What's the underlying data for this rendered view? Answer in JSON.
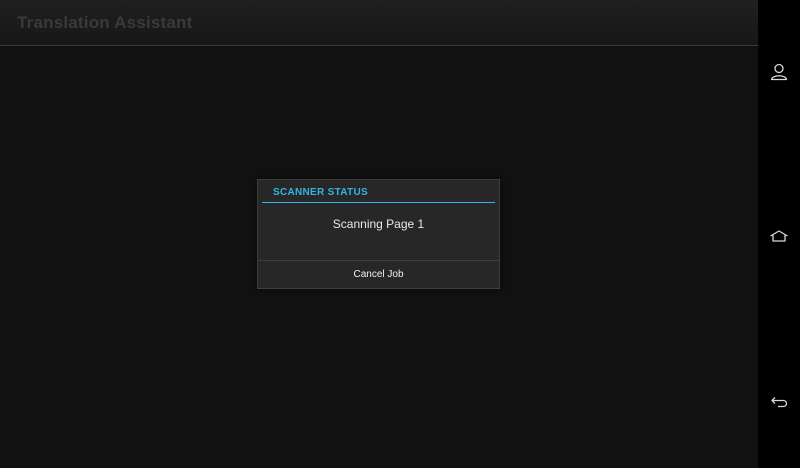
{
  "app": {
    "title": "Translation Assistant"
  },
  "dialog": {
    "title": "SCANNER STATUS",
    "message": "Scanning Page 1",
    "cancel_label": "Cancel Job"
  },
  "nav": {
    "buttons": [
      {
        "name": "account",
        "icon": "person-icon"
      },
      {
        "name": "home",
        "icon": "home-icon"
      },
      {
        "name": "back",
        "icon": "back-arrow-icon"
      }
    ]
  },
  "colors": {
    "accent": "#33b5e5",
    "background": "#111111",
    "nav_bar": "#000000",
    "dialog_bg": "#272727"
  }
}
